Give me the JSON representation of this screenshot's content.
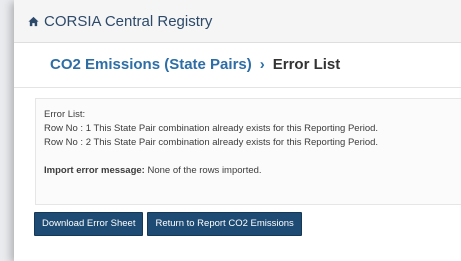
{
  "header": {
    "title": "CORSIA Central Registry",
    "icon": "home-icon"
  },
  "breadcrumb": {
    "link": "CO2 Emissions (State Pairs)",
    "separator": "›",
    "current": "Error List"
  },
  "error_box": {
    "heading": "Error List:",
    "rows": [
      "Row No : 1 This State Pair combination already exists for this Reporting Period.",
      "Row No : 2 This State Pair combination already exists for this Reporting Period."
    ],
    "import_label": "Import error message:",
    "import_message": " None of the rows imported."
  },
  "buttons": {
    "download": "Download Error Sheet",
    "return": "Return to Report CO2 Emissions"
  },
  "colors": {
    "brand": "#2d4a6a",
    "link": "#2d6ea6",
    "button_bg": "#1e4b73"
  }
}
